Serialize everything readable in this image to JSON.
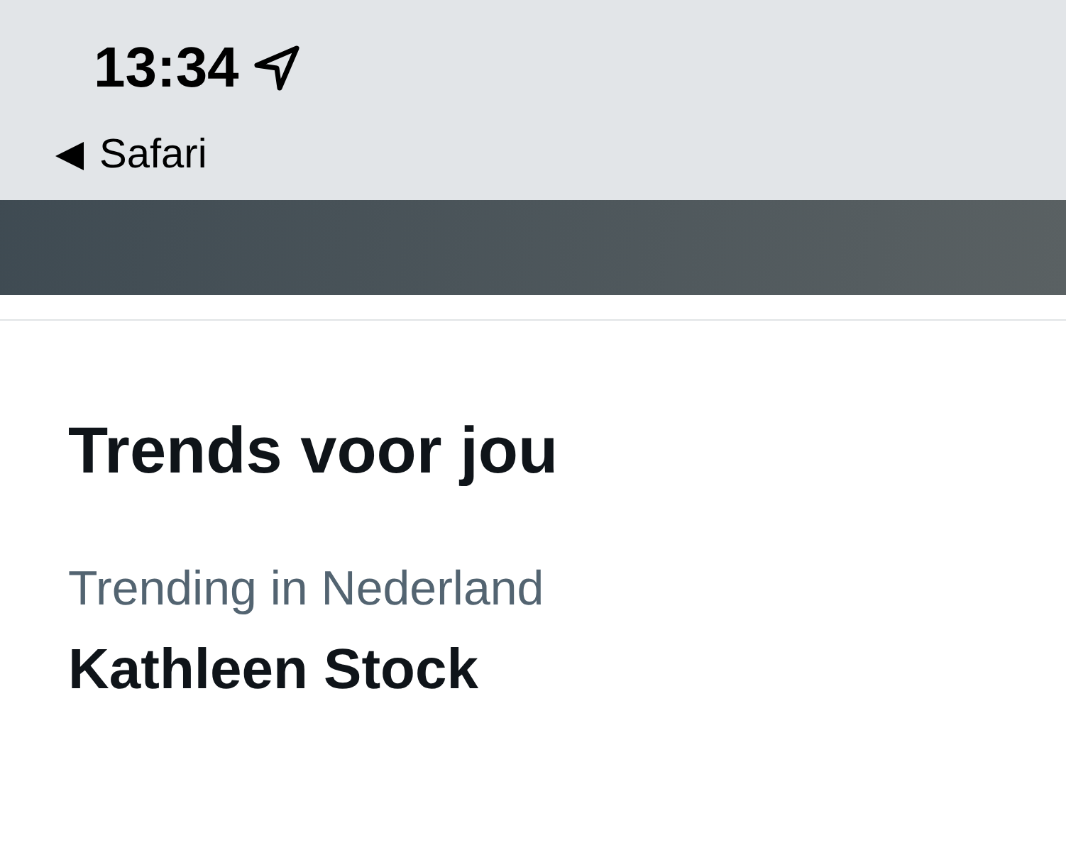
{
  "status_bar": {
    "time": "13:34",
    "back_app": "Safari"
  },
  "section": {
    "title": "Trends voor jou"
  },
  "trends": [
    {
      "context": "Trending in Nederland",
      "name": "Kathleen Stock"
    }
  ]
}
